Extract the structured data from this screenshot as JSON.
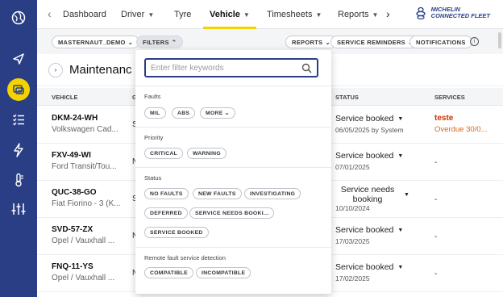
{
  "sidebar": {
    "icons": [
      "globe-icon",
      "navigation-arrow-icon",
      "maintenance-vehicle-icon",
      "checklist-icon",
      "lightning-icon",
      "temperature-icon",
      "sliders-icon"
    ]
  },
  "topnav": {
    "tabs": [
      {
        "label": "Dashboard"
      },
      {
        "label": "Driver"
      },
      {
        "label": "Tyre"
      },
      {
        "label": "Vehicle"
      },
      {
        "label": "Timesheets"
      },
      {
        "label": "Reports"
      }
    ],
    "prev_arrow": "‹",
    "next_arrow": "›",
    "brand_line1": "MICHELIN",
    "brand_line2": "CONNECTED FLEET"
  },
  "filterbar": {
    "account": "MASTERNAUT_DEMO",
    "filters": "FILTERS",
    "reports": "REPORTS",
    "service_reminders": "SERVICE REMINDERS",
    "notifications": "NOTIFICATIONS",
    "info": "i"
  },
  "page": {
    "title": "Maintenanc",
    "back_glyph": "›",
    "columns": {
      "vehicle": "VEHICLE",
      "g": "G",
      "status": "STATUS",
      "services": "SERVICES"
    }
  },
  "rows": [
    {
      "reg": "DKM-24-WH",
      "model": "Volkswagen Cad...",
      "g": "S",
      "status": "Service booked",
      "date": "06/05/2025 by System",
      "service_alert": "teste",
      "service_overdue": "Overdue 30/0..."
    },
    {
      "reg": "FXV-49-WI",
      "model": "Ford Transit/Tou...",
      "g": "N",
      "status": "Service booked",
      "date": "07/01/2025",
      "service": "-"
    },
    {
      "reg": "QUC-38-GO",
      "model": "Fiat Fiorino - 3 (K...",
      "g": "S",
      "status": "Service needs booking",
      "date": "10/10/2024",
      "service": "-"
    },
    {
      "reg": "SVD-57-ZX",
      "model": "Opel / Vauxhall ...",
      "g": "N",
      "status": "Service booked",
      "date": "17/03/2025",
      "service": "-"
    },
    {
      "reg": "FNQ-11-YS",
      "model": "Opel / Vauxhall ...",
      "g": "N",
      "status": "Service booked",
      "date": "17/02/2025",
      "service": "-"
    }
  ],
  "filter_panel": {
    "search_placeholder": "Enter filter keywords",
    "faults": {
      "label": "Faults",
      "chips": [
        "MIL",
        "ABS",
        "MORE"
      ]
    },
    "priority": {
      "label": "Priority",
      "chips": [
        "CRITICAL",
        "WARNING"
      ]
    },
    "status": {
      "label": "Status",
      "chips": [
        "NO FAULTS",
        "NEW FAULTS",
        "INVESTIGATING",
        "DEFERRED",
        "SERVICE NEEDS BOOKI...",
        "SERVICE BOOKED"
      ]
    },
    "remote": {
      "label": "Remote fault service detection",
      "chips": [
        "COMPATIBLE",
        "INCOMPATIBLE"
      ]
    }
  },
  "colors": {
    "sidebar": "#2a3e86",
    "accent": "#f5d300",
    "alert": "#cc3300",
    "overdue": "#d2691e"
  }
}
